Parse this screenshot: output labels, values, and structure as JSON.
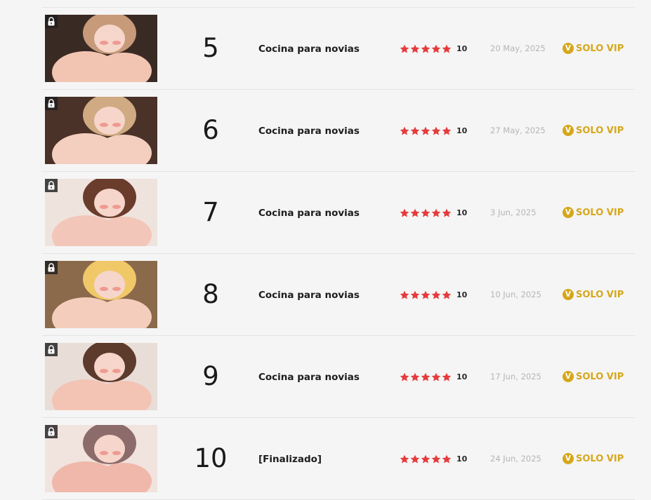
{
  "colors": {
    "star": "#e63b3b",
    "vip_gold": "#d6a71b",
    "date": "#b5b5b5",
    "divider": "#e4e4e4",
    "background": "#f5f5f5"
  },
  "icons": {
    "lock": "lock-icon",
    "star": "star-icon",
    "vip": "vip-coin-icon"
  },
  "chapters": [
    {
      "number": "5",
      "title": "Cocina para novias",
      "stars": 5,
      "rating": "10",
      "date": "20 May, 2025",
      "vip_icon": "V",
      "access": "SOLO VIP",
      "thumb_palette": [
        "#3a2a24",
        "#f2c4b2",
        "#c79a7a"
      ]
    },
    {
      "number": "6",
      "title": "Cocina para novias",
      "stars": 5,
      "rating": "10",
      "date": "27 May, 2025",
      "vip_icon": "V",
      "access": "SOLO VIP",
      "thumb_palette": [
        "#4a3228",
        "#f4cfc0",
        "#d0aa82"
      ]
    },
    {
      "number": "7",
      "title": "Cocina para novias",
      "stars": 5,
      "rating": "10",
      "date": "3 Jun, 2025",
      "vip_icon": "V",
      "access": "SOLO VIP",
      "thumb_palette": [
        "#efe3de",
        "#f2c6b8",
        "#6a3c2c"
      ]
    },
    {
      "number": "8",
      "title": "Cocina para novias",
      "stars": 5,
      "rating": "10",
      "date": "10 Jun, 2025",
      "vip_icon": "V",
      "access": "SOLO VIP",
      "thumb_palette": [
        "#8a6a4a",
        "#f5cdbd",
        "#f0c868"
      ]
    },
    {
      "number": "9",
      "title": "Cocina para novias",
      "stars": 5,
      "rating": "10",
      "date": "17 Jun, 2025",
      "vip_icon": "V",
      "access": "SOLO VIP",
      "thumb_palette": [
        "#e9ddd8",
        "#f3c4b4",
        "#5c3a2c"
      ]
    },
    {
      "number": "10",
      "title": "[Finalizado]",
      "stars": 5,
      "rating": "10",
      "date": "24 Jun, 2025",
      "vip_icon": "V",
      "access": "SOLO VIP",
      "thumb_palette": [
        "#f1e3de",
        "#f0b8aa",
        "#8c6c6a"
      ]
    }
  ]
}
